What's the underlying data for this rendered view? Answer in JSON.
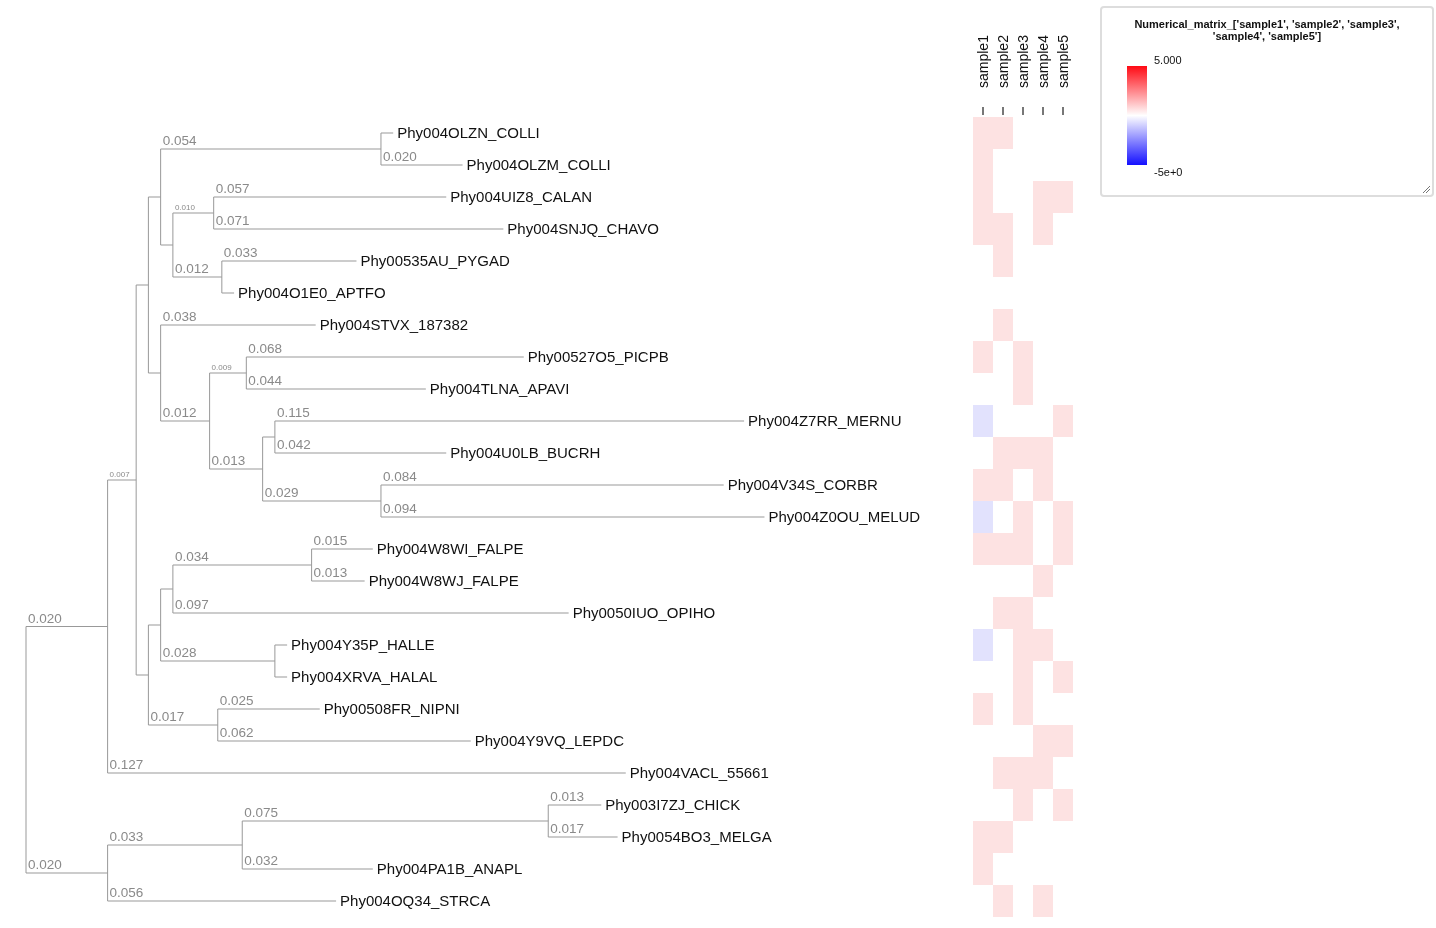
{
  "tree": {
    "children": [
      {
        "label": "0.020",
        "children": [
          {
            "label": "0.007",
            "children": [
              {
                "children": [
                  {
                    "children": [
                      {
                        "label": "0.054",
                        "children": [
                          {
                            "name": "Phy004OLZN_COLLI"
                          },
                          {
                            "name": "Phy004OLZM_COLLI",
                            "label": "0.020"
                          }
                        ]
                      },
                      {
                        "children": [
                          {
                            "label": "0.010",
                            "children": [
                              {
                                "name": "Phy004UIZ8_CALAN",
                                "label": "0.057"
                              },
                              {
                                "name": "Phy004SNJQ_CHAVO",
                                "label": "0.071"
                              }
                            ]
                          },
                          {
                            "label": "0.012",
                            "children": [
                              {
                                "name": "Phy00535AU_PYGAD",
                                "label": "0.033"
                              },
                              {
                                "name": "Phy004O1E0_APTFO"
                              }
                            ]
                          }
                        ]
                      }
                    ]
                  },
                  {
                    "children": [
                      {
                        "name": "Phy004STVX_187382",
                        "label": "0.038"
                      },
                      {
                        "label": "0.012",
                        "children": [
                          {
                            "label": "0.009",
                            "children": [
                              {
                                "name": "Phy00527O5_PICPB",
                                "label": "0.068"
                              },
                              {
                                "name": "Phy004TLNA_APAVI",
                                "label": "0.044"
                              }
                            ]
                          },
                          {
                            "label": "0.013",
                            "children": [
                              {
                                "children": [
                                  {
                                    "name": "Phy004Z7RR_MERNU",
                                    "label": "0.115"
                                  },
                                  {
                                    "name": "Phy004U0LB_BUCRH",
                                    "label": "0.042"
                                  }
                                ]
                              },
                              {
                                "label": "0.029",
                                "children": [
                                  {
                                    "name": "Phy004V34S_CORBR",
                                    "label": "0.084"
                                  },
                                  {
                                    "name": "Phy004Z0OU_MELUD",
                                    "label": "0.094"
                                  }
                                ]
                              }
                            ]
                          }
                        ]
                      }
                    ]
                  }
                ]
              },
              {
                "children": [
                  {
                    "children": [
                      {
                        "children": [
                          {
                            "label": "0.034",
                            "children": [
                              {
                                "name": "Phy004W8WI_FALPE",
                                "label": "0.015"
                              },
                              {
                                "name": "Phy004W8WJ_FALPE",
                                "label": "0.013"
                              }
                            ]
                          },
                          {
                            "name": "Phy0050IUO_OPIHO",
                            "label": "0.097"
                          }
                        ]
                      },
                      {
                        "label": "0.028",
                        "children": [
                          {
                            "name": "Phy004Y35P_HALLE"
                          },
                          {
                            "name": "Phy004XRVA_HALAL"
                          }
                        ]
                      }
                    ]
                  },
                  {
                    "label": "0.017",
                    "children": [
                      {
                        "name": "Phy00508FR_NIPNI",
                        "label": "0.025"
                      },
                      {
                        "name": "Phy004Y9VQ_LEPDC",
                        "label": "0.062"
                      }
                    ]
                  }
                ]
              }
            ]
          },
          {
            "name": "Phy004VACL_55661",
            "label": "0.127"
          }
        ]
      },
      {
        "label": "0.020",
        "children": [
          {
            "label": "0.033",
            "children": [
              {
                "label": "0.075",
                "children": [
                  {
                    "name": "Phy003I7ZJ_CHICK",
                    "label": "0.013"
                  },
                  {
                    "name": "Phy0054BO3_MELGA",
                    "label": "0.017"
                  }
                ]
              },
              {
                "name": "Phy004PA1B_ANAPL",
                "label": "0.032"
              }
            ]
          },
          {
            "name": "Phy004OQ34_STRCA",
            "label": "0.056"
          }
        ]
      }
    ]
  },
  "heatmap": {
    "columns": [
      "sample1",
      "sample2",
      "sample3",
      "sample4",
      "sample5"
    ],
    "rows": [
      {
        "cells": [
          {
            "color": "#fde2e2"
          },
          {
            "color": "#fde2e2"
          },
          {
            "color": "#ffffff"
          },
          {
            "color": "#ffffff"
          },
          {
            "color": "#ffffff"
          }
        ]
      },
      {
        "cells": [
          {
            "color": "#fde2e2"
          },
          {
            "color": "#ffffff"
          },
          {
            "color": "#ffffff"
          },
          {
            "color": "#ffffff"
          },
          {
            "color": "#ffffff"
          }
        ]
      },
      {
        "cells": [
          {
            "color": "#fde2e2"
          },
          {
            "color": "#ffffff"
          },
          {
            "color": "#ffffff"
          },
          {
            "color": "#fde2e2"
          },
          {
            "color": "#fde2e2"
          }
        ]
      },
      {
        "cells": [
          {
            "color": "#fde2e2"
          },
          {
            "color": "#fde2e2"
          },
          {
            "color": "#ffffff"
          },
          {
            "color": "#fde2e2"
          },
          {
            "color": "#ffffff"
          }
        ]
      },
      {
        "cells": [
          {
            "color": "#ffffff"
          },
          {
            "color": "#fde2e2"
          },
          {
            "color": "#ffffff"
          },
          {
            "color": "#ffffff"
          },
          {
            "color": "#ffffff"
          }
        ]
      },
      {
        "cells": [
          {
            "color": "#ffffff"
          },
          {
            "color": "#ffffff"
          },
          {
            "color": "#ffffff"
          },
          {
            "color": "#ffffff"
          },
          {
            "color": "#ffffff"
          }
        ]
      },
      {
        "cells": [
          {
            "color": "#ffffff"
          },
          {
            "color": "#fde2e2"
          },
          {
            "color": "#ffffff"
          },
          {
            "color": "#ffffff"
          },
          {
            "color": "#ffffff"
          }
        ]
      },
      {
        "cells": [
          {
            "color": "#fde2e2"
          },
          {
            "color": "#ffffff"
          },
          {
            "color": "#fde2e2"
          },
          {
            "color": "#ffffff"
          },
          {
            "color": "#ffffff"
          }
        ]
      },
      {
        "cells": [
          {
            "color": "#ffffff"
          },
          {
            "color": "#ffffff"
          },
          {
            "color": "#fde2e2"
          },
          {
            "color": "#ffffff"
          },
          {
            "color": "#ffffff"
          }
        ]
      },
      {
        "cells": [
          {
            "color": "#e2e2fd"
          },
          {
            "color": "#ffffff"
          },
          {
            "color": "#ffffff"
          },
          {
            "color": "#ffffff"
          },
          {
            "color": "#fde2e2"
          }
        ]
      },
      {
        "cells": [
          {
            "color": "#ffffff"
          },
          {
            "color": "#fde2e2"
          },
          {
            "color": "#fde2e2"
          },
          {
            "color": "#fde2e2"
          },
          {
            "color": "#ffffff"
          }
        ]
      },
      {
        "cells": [
          {
            "color": "#fde2e2"
          },
          {
            "color": "#fde2e2"
          },
          {
            "color": "#ffffff"
          },
          {
            "color": "#fde2e2"
          },
          {
            "color": "#ffffff"
          }
        ]
      },
      {
        "cells": [
          {
            "color": "#e2e2fd"
          },
          {
            "color": "#ffffff"
          },
          {
            "color": "#fde2e2"
          },
          {
            "color": "#ffffff"
          },
          {
            "color": "#fde2e2"
          }
        ]
      },
      {
        "cells": [
          {
            "color": "#fde2e2"
          },
          {
            "color": "#fde2e2"
          },
          {
            "color": "#fde2e2"
          },
          {
            "color": "#ffffff"
          },
          {
            "color": "#fde2e2"
          }
        ]
      },
      {
        "cells": [
          {
            "color": "#ffffff"
          },
          {
            "color": "#ffffff"
          },
          {
            "color": "#ffffff"
          },
          {
            "color": "#fde2e2"
          },
          {
            "color": "#ffffff"
          }
        ]
      },
      {
        "cells": [
          {
            "color": "#ffffff"
          },
          {
            "color": "#fde2e2"
          },
          {
            "color": "#fde2e2"
          },
          {
            "color": "#ffffff"
          },
          {
            "color": "#ffffff"
          }
        ]
      },
      {
        "cells": [
          {
            "color": "#e2e2fd"
          },
          {
            "color": "#ffffff"
          },
          {
            "color": "#fde2e2"
          },
          {
            "color": "#fde2e2"
          },
          {
            "color": "#ffffff"
          }
        ]
      },
      {
        "cells": [
          {
            "color": "#ffffff"
          },
          {
            "color": "#ffffff"
          },
          {
            "color": "#fde2e2"
          },
          {
            "color": "#ffffff"
          },
          {
            "color": "#fde2e2"
          }
        ]
      },
      {
        "cells": [
          {
            "color": "#fde2e2"
          },
          {
            "color": "#ffffff"
          },
          {
            "color": "#fde2e2"
          },
          {
            "color": "#ffffff"
          },
          {
            "color": "#ffffff"
          }
        ]
      },
      {
        "cells": [
          {
            "color": "#ffffff"
          },
          {
            "color": "#ffffff"
          },
          {
            "color": "#ffffff"
          },
          {
            "color": "#fde2e2"
          },
          {
            "color": "#fde2e2"
          }
        ]
      },
      {
        "cells": [
          {
            "color": "#ffffff"
          },
          {
            "color": "#fde2e2"
          },
          {
            "color": "#fde2e2"
          },
          {
            "color": "#fde2e2"
          },
          {
            "color": "#ffffff"
          }
        ]
      },
      {
        "cells": [
          {
            "color": "#ffffff"
          },
          {
            "color": "#ffffff"
          },
          {
            "color": "#fde2e2"
          },
          {
            "color": "#ffffff"
          },
          {
            "color": "#fde2e2"
          }
        ]
      },
      {
        "cells": [
          {
            "color": "#fde2e2"
          },
          {
            "color": "#fde2e2"
          },
          {
            "color": "#ffffff"
          },
          {
            "color": "#ffffff"
          },
          {
            "color": "#ffffff"
          }
        ]
      },
      {
        "cells": [
          {
            "color": "#fde2e2"
          },
          {
            "color": "#ffffff"
          },
          {
            "color": "#ffffff"
          },
          {
            "color": "#ffffff"
          },
          {
            "color": "#ffffff"
          }
        ]
      },
      {
        "cells": [
          {
            "color": "#ffffff"
          },
          {
            "color": "#fde2e2"
          },
          {
            "color": "#ffffff"
          },
          {
            "color": "#fde2e2"
          },
          {
            "color": "#ffffff"
          }
        ]
      }
    ]
  },
  "legend": {
    "title": "Numerical_matrix_['sample1', 'sample2', 'sample3', 'sample4', 'sample5']",
    "max_label": "5.000",
    "min_label": "-5e+0"
  }
}
